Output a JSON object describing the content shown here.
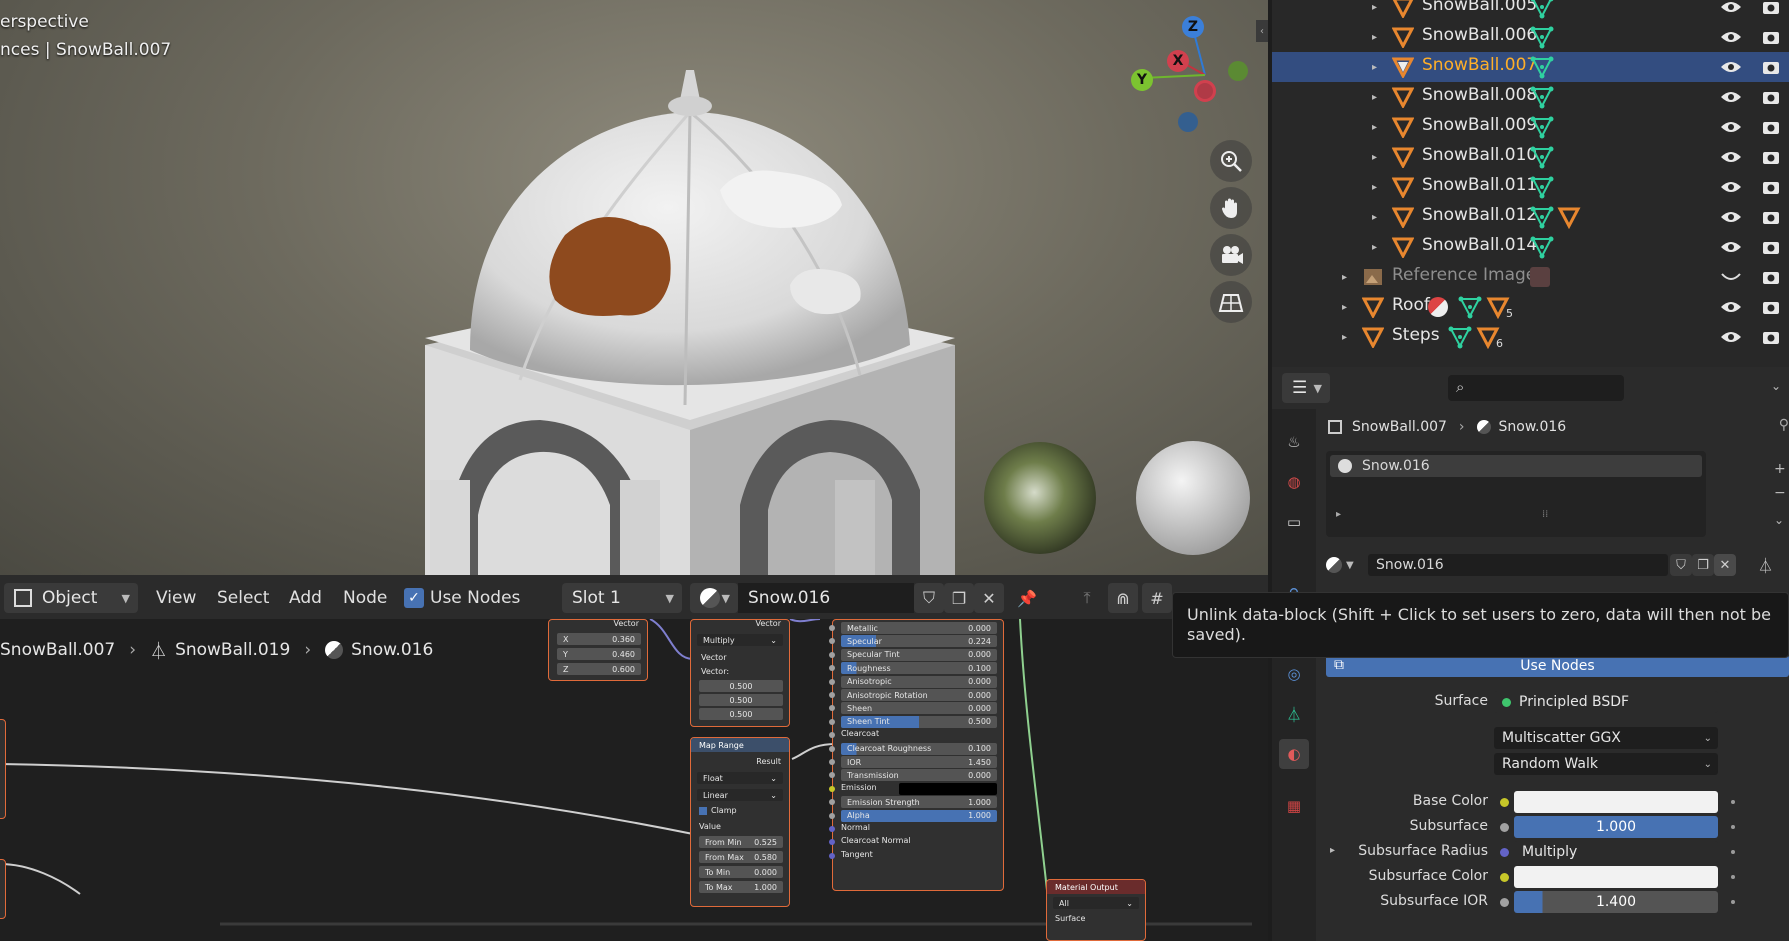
{
  "viewport": {
    "info_line1": "erspective",
    "info_line2": "nces | SnowBall.007",
    "gizmo": {
      "z": "Z",
      "x": "X",
      "y": "Y"
    },
    "nav_buttons": [
      "zoom-icon",
      "hand-icon",
      "camera-icon",
      "grid-icon"
    ]
  },
  "outliner": {
    "rows": [
      {
        "label": "SnowBall.005",
        "selected": false
      },
      {
        "label": "SnowBall.006",
        "selected": false
      },
      {
        "label": "SnowBall.007",
        "selected": true
      },
      {
        "label": "SnowBall.008",
        "selected": false
      },
      {
        "label": "SnowBall.009",
        "selected": false
      },
      {
        "label": "SnowBall.010",
        "selected": false
      },
      {
        "label": "SnowBall.011",
        "selected": false
      },
      {
        "label": "SnowBall.012",
        "selected": false
      },
      {
        "label": "SnowBall.014",
        "selected": false
      },
      {
        "label": "Reference Image",
        "selected": false
      },
      {
        "label": "Roof",
        "selected": false
      },
      {
        "label": "Steps",
        "selected": false
      }
    ],
    "roof_count": "5",
    "steps_count": "6"
  },
  "node_header": {
    "mode": "Object",
    "menu": [
      "View",
      "Select",
      "Add",
      "Node"
    ],
    "use_nodes": "Use Nodes",
    "slot": "Slot 1",
    "material": "Snow.016"
  },
  "node_breadcrumb": [
    "SnowBall.007",
    "SnowBall.019",
    "Snow.016"
  ],
  "nodes": {
    "combine": {
      "vector_out": "Vector",
      "x": "0.360",
      "y": "0.460",
      "z": "0.600",
      "x_label": "X",
      "y_label": "Y",
      "z_label": "Z"
    },
    "vector_math": {
      "vector_out": "Vector",
      "operation": "Multiply",
      "in1": "Vector",
      "in2": "Vector:",
      "v1": "0.500",
      "v2": "0.500",
      "v3": "0.500"
    },
    "map_range": {
      "title": "Map Range",
      "result": "Result",
      "type": "Float",
      "interp": "Linear",
      "clamp": "Clamp",
      "value": "Value",
      "fields": [
        {
          "label": "From Min",
          "value": "0.525"
        },
        {
          "label": "From Max",
          "value": "0.580"
        },
        {
          "label": "To Min",
          "value": "0.000"
        },
        {
          "label": "To Max",
          "value": "1.000"
        }
      ]
    },
    "bsdf": {
      "fields": [
        {
          "label": "Metallic",
          "value": "0.000",
          "fill": 0
        },
        {
          "label": "Specular",
          "value": "0.224",
          "fill": 22.4
        },
        {
          "label": "Specular Tint",
          "value": "0.000",
          "fill": 0
        },
        {
          "label": "Roughness",
          "value": "0.100",
          "fill": 10
        },
        {
          "label": "Anisotropic",
          "value": "0.000",
          "fill": 0
        },
        {
          "label": "Anisotropic Rotation",
          "value": "0.000",
          "fill": 0
        },
        {
          "label": "Sheen",
          "value": "0.000",
          "fill": 0
        },
        {
          "label": "Sheen Tint",
          "value": "0.500",
          "fill": 50
        }
      ],
      "clearcoat": "Clearcoat",
      "fields2": [
        {
          "label": "Clearcoat Roughness",
          "value": "0.100",
          "fill": 10
        },
        {
          "label": "IOR",
          "value": "1.450",
          "fill": 0
        },
        {
          "label": "Transmission",
          "value": "0.000",
          "fill": 0
        }
      ],
      "emission": "Emission",
      "fields3": [
        {
          "label": "Emission Strength",
          "value": "1.000",
          "fill": 0
        },
        {
          "label": "Alpha",
          "value": "1.000",
          "fill": 100
        }
      ],
      "normal": "Normal",
      "clearcoat_normal": "Clearcoat Normal",
      "tangent": "Tangent"
    },
    "material_output": {
      "title": "Material Output",
      "target": "All",
      "surface": "Surface"
    }
  },
  "tooltip": "Unlink data-block (Shift + Click to set users to zero, data will then not be saved).",
  "properties": {
    "breadcrumb": [
      "SnowBall.007",
      "Snow.016"
    ],
    "slot_name": "Snow.016",
    "material_field": "Snow.016",
    "use_nodes": "Use Nodes",
    "surface_label": "Surface",
    "surface_value": "Principled BSDF",
    "distribution": "Multiscatter GGX",
    "subsurface_method": "Random Walk",
    "rows": [
      {
        "label": "Base Color",
        "type": "color",
        "value": ""
      },
      {
        "label": "Subsurface",
        "type": "slider",
        "value": "1.000",
        "fill": 100
      },
      {
        "label": "Subsurface Radius",
        "type": "link",
        "value": "Multiply"
      },
      {
        "label": "Subsurface Color",
        "type": "color",
        "value": ""
      },
      {
        "label": "Subsurface IOR",
        "type": "slider",
        "value": "1.400",
        "fill": 14
      }
    ]
  },
  "colors": {
    "accent": "#4772b3",
    "selected_row": "#334d80",
    "selected_text": "#ffaf29",
    "object_orange": "#e8872f",
    "mesh_green": "#2fd1a0"
  }
}
